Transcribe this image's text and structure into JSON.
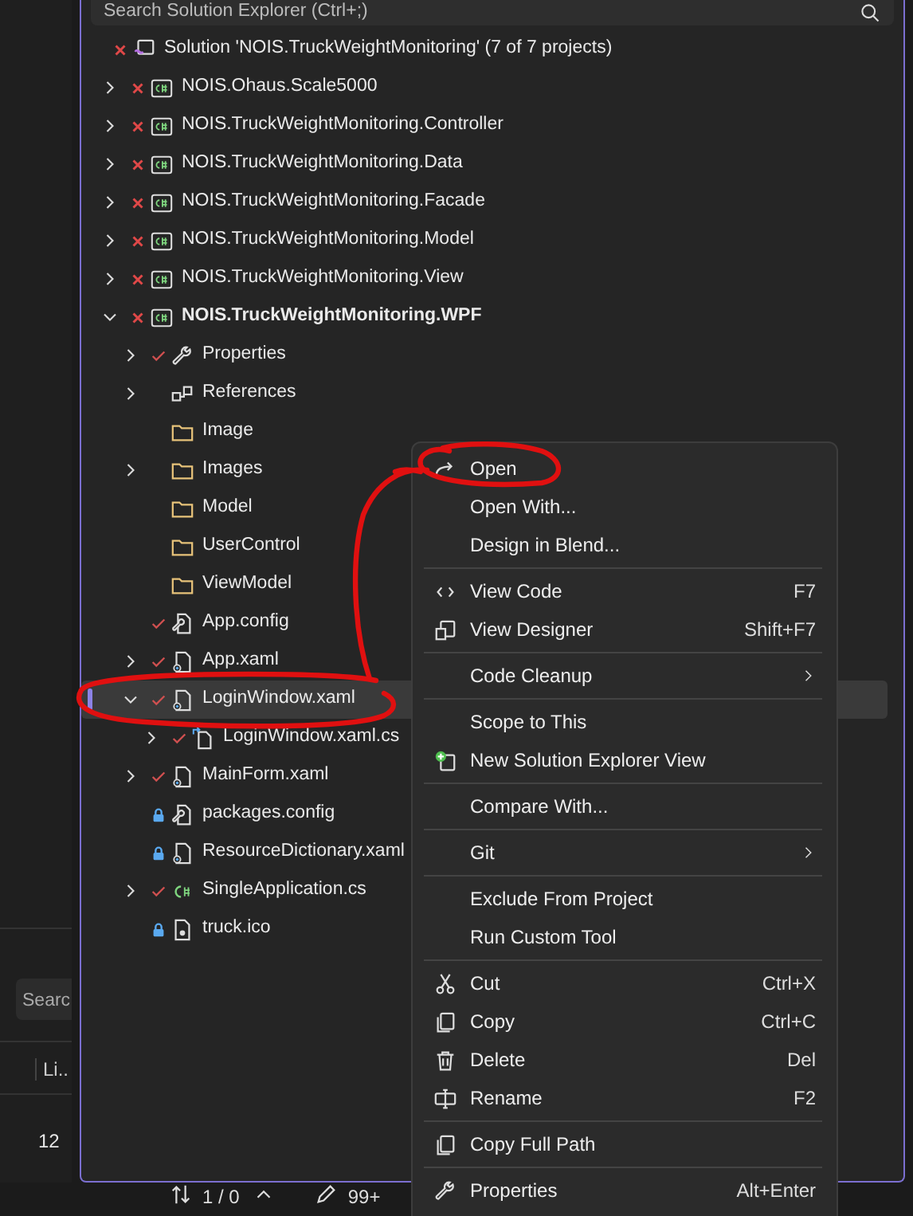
{
  "search": {
    "placeholder": "Search Solution Explorer (Ctrl+;)"
  },
  "tree": [
    {
      "label": "Solution 'NOIS.TruckWeightMonitoring' (7 of 7 projects)",
      "kind": "solution",
      "error": true,
      "children": [
        {
          "label": "NOIS.Ohaus.Scale5000",
          "kind": "project",
          "error": true,
          "expanded": false,
          "startup": false
        },
        {
          "label": "NOIS.TruckWeightMonitoring.Controller",
          "kind": "project",
          "error": true,
          "expanded": false,
          "startup": false
        },
        {
          "label": "NOIS.TruckWeightMonitoring.Data",
          "kind": "project",
          "error": true,
          "expanded": false,
          "startup": false
        },
        {
          "label": "NOIS.TruckWeightMonitoring.Facade",
          "kind": "project",
          "error": true,
          "expanded": false,
          "startup": false
        },
        {
          "label": "NOIS.TruckWeightMonitoring.Model",
          "kind": "project",
          "error": true,
          "expanded": false,
          "startup": false
        },
        {
          "label": "NOIS.TruckWeightMonitoring.View",
          "kind": "project",
          "error": true,
          "expanded": false,
          "startup": false
        },
        {
          "label": "NOIS.TruckWeightMonitoring.WPF",
          "kind": "project",
          "error": true,
          "expanded": true,
          "startup": true,
          "children": [
            {
              "label": "Properties",
              "kind": "properties",
              "pending_change": true,
              "locked": false,
              "expanded": false
            },
            {
              "label": "References",
              "kind": "references",
              "pending_change": false,
              "locked": false,
              "expanded": false
            },
            {
              "label": "Image",
              "kind": "folder",
              "pending_change": false,
              "locked": false
            },
            {
              "label": "Images",
              "kind": "folder",
              "pending_change": false,
              "locked": false,
              "expanded": false
            },
            {
              "label": "Model",
              "kind": "folder",
              "pending_change": false,
              "locked": false
            },
            {
              "label": "UserControl",
              "kind": "folder",
              "pending_change": false,
              "locked": false
            },
            {
              "label": "ViewModel",
              "kind": "folder",
              "pending_change": false,
              "locked": false
            },
            {
              "label": "App.config",
              "kind": "config",
              "pending_change": true,
              "locked": false
            },
            {
              "label": "App.xaml",
              "kind": "xaml",
              "pending_change": true,
              "locked": false,
              "expanded": false
            },
            {
              "label": "LoginWindow.xaml",
              "kind": "xaml",
              "pending_change": true,
              "locked": false,
              "expanded": true,
              "selected": true,
              "children": [
                {
                  "label": "LoginWindow.xaml.cs",
                  "kind": "codebehind",
                  "pending_change": true,
                  "locked": false,
                  "expanded": false
                }
              ]
            },
            {
              "label": "MainForm.xaml",
              "kind": "xaml",
              "pending_change": true,
              "locked": false,
              "expanded": false
            },
            {
              "label": "packages.config",
              "kind": "config",
              "pending_change": false,
              "locked": true
            },
            {
              "label": "ResourceDictionary.xaml",
              "kind": "xaml",
              "pending_change": false,
              "locked": true
            },
            {
              "label": "SingleApplication.cs",
              "kind": "csharp",
              "pending_change": true,
              "locked": false,
              "expanded": false
            },
            {
              "label": "truck.ico",
              "kind": "icon_file",
              "pending_change": false,
              "locked": true
            }
          ]
        }
      ]
    }
  ],
  "context_menu": [
    [
      {
        "label": "Open",
        "kind": "open"
      },
      {
        "label": "Open With...",
        "kind": "plain"
      },
      {
        "label": "Design in Blend...",
        "kind": "plain"
      }
    ],
    [
      {
        "label": "View Code",
        "kind": "code",
        "shortcut": "F7"
      },
      {
        "label": "View Designer",
        "kind": "designer",
        "shortcut": "Shift+F7"
      }
    ],
    [
      {
        "label": "Code Cleanup",
        "kind": "submenu"
      }
    ],
    [
      {
        "label": "Scope to This",
        "kind": "plain"
      },
      {
        "label": "New Solution Explorer View",
        "kind": "new_view"
      }
    ],
    [
      {
        "label": "Compare With...",
        "kind": "plain"
      }
    ],
    [
      {
        "label": "Git",
        "kind": "submenu"
      }
    ],
    [
      {
        "label": "Exclude From Project",
        "kind": "plain"
      },
      {
        "label": "Run Custom Tool",
        "kind": "plain"
      }
    ],
    [
      {
        "label": "Cut",
        "kind": "cut",
        "shortcut": "Ctrl+X"
      },
      {
        "label": "Copy",
        "kind": "copy",
        "shortcut": "Ctrl+C"
      },
      {
        "label": "Delete",
        "kind": "delete",
        "shortcut": "Del"
      },
      {
        "label": "Rename",
        "kind": "rename",
        "shortcut": "F2"
      }
    ],
    [
      {
        "label": "Copy Full Path",
        "kind": "copy"
      }
    ],
    [
      {
        "label": "Properties",
        "kind": "properties",
        "shortcut": "Alt+Enter"
      }
    ]
  ],
  "side_panel": {
    "search_placeholder": "Searc",
    "column_1": "Li..",
    "rows": [
      "12"
    ]
  },
  "status_bar": {
    "changes": "1 / 0",
    "edits": "99+"
  }
}
